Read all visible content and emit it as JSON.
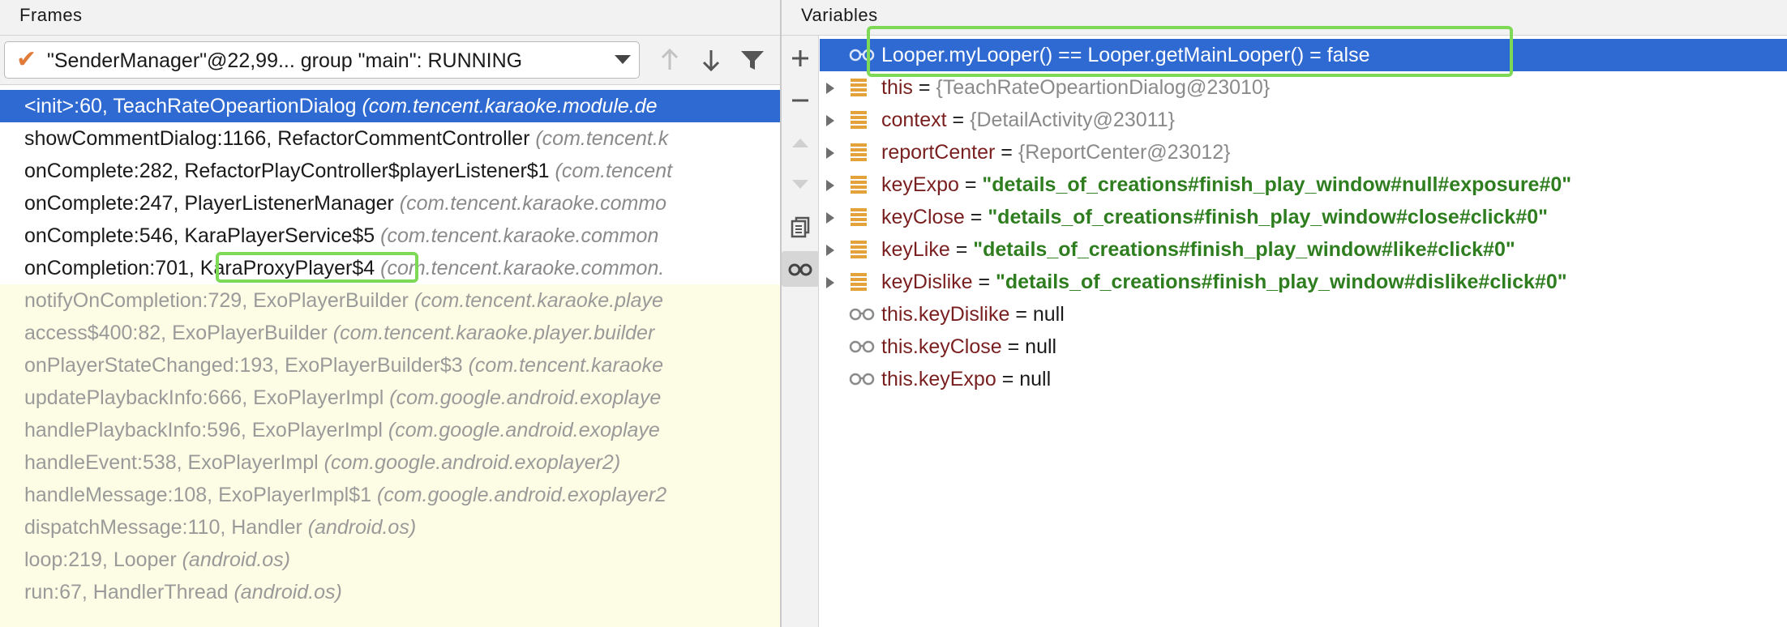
{
  "frames": {
    "title": "Frames",
    "thread_selector": "\"SenderManager\"@22,99... group \"main\": RUNNING",
    "rows": [
      {
        "method": "<init>:60, TeachRateOpeartionDialog ",
        "pkg": "(com.tencent.karaoke.module.de",
        "kind": "selected"
      },
      {
        "method": "showCommentDialog:1166, RefactorCommentController ",
        "pkg": "(com.tencent.k",
        "kind": "app"
      },
      {
        "method": "onComplete:282, RefactorPlayController$playerListener$1 ",
        "pkg": "(com.tencent",
        "kind": "app"
      },
      {
        "method": "onComplete:247, PlayerListenerManager ",
        "pkg": "(com.tencent.karaoke.commo",
        "kind": "app"
      },
      {
        "method": "onComplete:546, KaraPlayerService$5 ",
        "pkg": "(com.tencent.karaoke.common",
        "kind": "app"
      },
      {
        "method": "onCompletion:701, KaraProxyPlayer$4 ",
        "pkg": "(com.tencent.karaoke.common.",
        "kind": "app"
      },
      {
        "method": "notifyOnCompletion:729, ExoPlayerBuilder ",
        "pkg": "(com.tencent.karaoke.playe",
        "kind": "lib"
      },
      {
        "method": "access$400:82, ExoPlayerBuilder ",
        "pkg": "(com.tencent.karaoke.player.builder",
        "kind": "lib"
      },
      {
        "method": "onPlayerStateChanged:193, ExoPlayerBuilder$3 ",
        "pkg": "(com.tencent.karaoke",
        "kind": "lib"
      },
      {
        "method": "updatePlaybackInfo:666, ExoPlayerImpl ",
        "pkg": "(com.google.android.exoplaye",
        "kind": "lib"
      },
      {
        "method": "handlePlaybackInfo:596, ExoPlayerImpl ",
        "pkg": "(com.google.android.exoplaye",
        "kind": "lib"
      },
      {
        "method": "handleEvent:538, ExoPlayerImpl ",
        "pkg": "(com.google.android.exoplayer2)",
        "kind": "lib"
      },
      {
        "method": "handleMessage:108, ExoPlayerImpl$1 ",
        "pkg": "(com.google.android.exoplayer2",
        "kind": "lib"
      },
      {
        "method": "dispatchMessage:110, Handler ",
        "pkg": "(android.os)",
        "kind": "lib"
      },
      {
        "method": "loop:219, Looper ",
        "pkg": "(android.os)",
        "kind": "lib"
      },
      {
        "method": "run:67, HandlerThread ",
        "pkg": "(android.os)",
        "kind": "lib"
      }
    ]
  },
  "variables": {
    "title": "Variables",
    "rows": [
      {
        "icon": "watch",
        "name": "Looper.myLooper() == Looper.getMainLooper()",
        "eq": " = ",
        "value": "false",
        "vtype": "bool",
        "selected": true
      },
      {
        "icon": "field",
        "name": "this",
        "eq": " = ",
        "value": "{TeachRateOpeartionDialog@23010}",
        "vtype": "obj",
        "expandable": true
      },
      {
        "icon": "field",
        "name": "context",
        "eq": " = ",
        "value": "{DetailActivity@23011}",
        "vtype": "obj",
        "expandable": true
      },
      {
        "icon": "field",
        "name": "reportCenter",
        "eq": " = ",
        "value": "{ReportCenter@23012}",
        "vtype": "obj",
        "expandable": true
      },
      {
        "icon": "field",
        "name": "keyExpo",
        "eq": " = ",
        "value": "\"details_of_creations#finish_play_window#null#exposure#0\"",
        "vtype": "str",
        "expandable": true
      },
      {
        "icon": "field",
        "name": "keyClose",
        "eq": " = ",
        "value": "\"details_of_creations#finish_play_window#close#click#0\"",
        "vtype": "str",
        "expandable": true
      },
      {
        "icon": "field",
        "name": "keyLike",
        "eq": " = ",
        "value": "\"details_of_creations#finish_play_window#like#click#0\"",
        "vtype": "str",
        "expandable": true
      },
      {
        "icon": "field",
        "name": "keyDislike",
        "eq": " = ",
        "value": "\"details_of_creations#finish_play_window#dislike#click#0\"",
        "vtype": "str",
        "expandable": true
      },
      {
        "icon": "watch",
        "name": "this.keyDislike",
        "eq": " = ",
        "value": "null",
        "vtype": "null"
      },
      {
        "icon": "watch",
        "name": "this.keyClose",
        "eq": " = ",
        "value": "null",
        "vtype": "null"
      },
      {
        "icon": "watch",
        "name": "this.keyExpo",
        "eq": " = ",
        "value": "null",
        "vtype": "null"
      }
    ]
  },
  "colors": {
    "selection": "#2e6ad1",
    "highlight_box": "#7ed957",
    "library_frame_bg": "#fdfde5",
    "string_value": "#2e7d1f",
    "field_name": "#7a1f1f"
  }
}
